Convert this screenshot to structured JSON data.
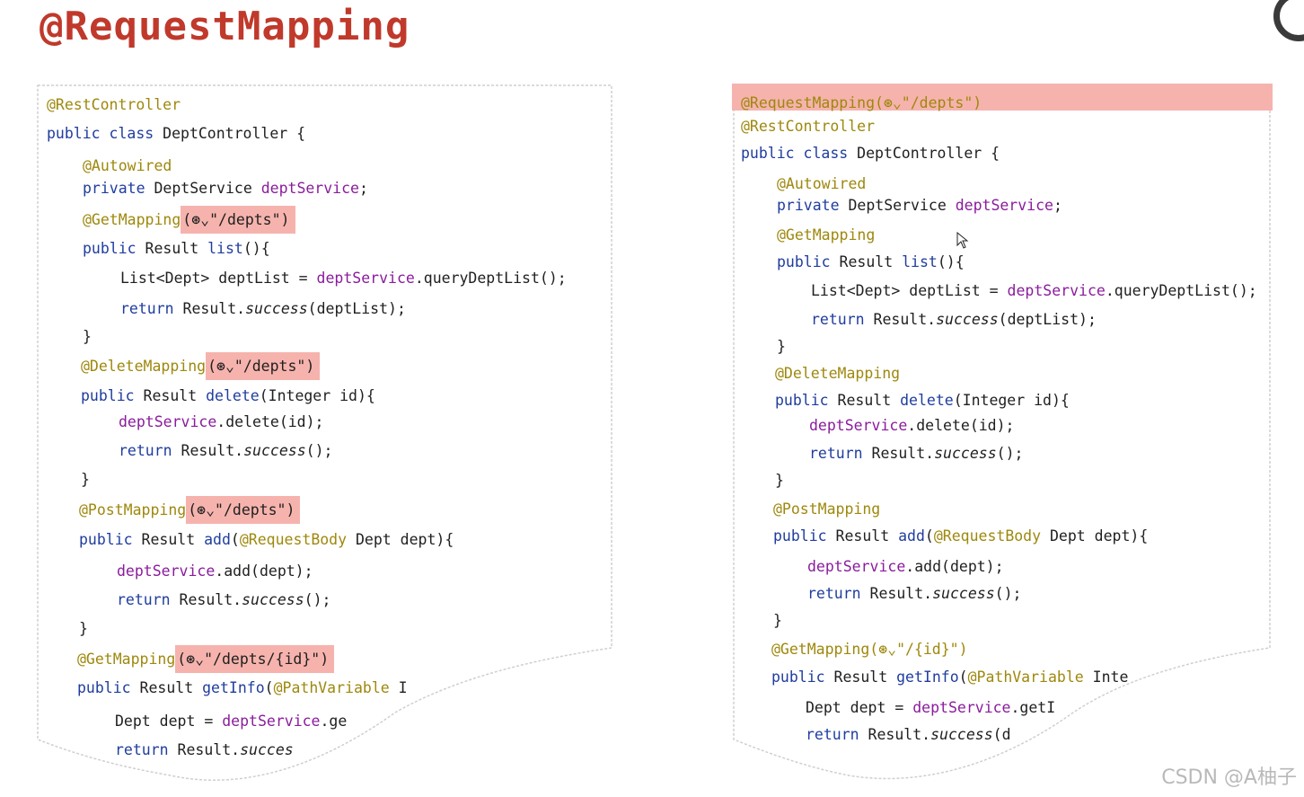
{
  "title": "@RequestMapping",
  "left": {
    "lines": [
      [
        {
          "t": "@RestController",
          "c": "ann"
        }
      ],
      [
        {
          "t": "public class ",
          "c": "kw"
        },
        {
          "t": "DeptController {",
          "c": ""
        }
      ],
      [
        {
          "t": "@Autowired",
          "c": "ann"
        }
      ],
      [
        {
          "t": "private ",
          "c": "kw"
        },
        {
          "t": "DeptService ",
          "c": ""
        },
        {
          "t": "deptService",
          "c": "fld"
        },
        {
          "t": ";",
          "c": ""
        }
      ],
      [
        {
          "t": "@GetMapping",
          "c": "ann"
        },
        {
          "t": "(⊛⌄\"/depts\")",
          "c": "hl"
        }
      ],
      [
        {
          "t": "public ",
          "c": "kw"
        },
        {
          "t": "Result ",
          "c": ""
        },
        {
          "t": "list",
          "c": "kw"
        },
        {
          "t": "(){",
          "c": ""
        }
      ],
      [
        {
          "t": "List<Dept> deptList = ",
          "c": ""
        },
        {
          "t": "deptService",
          "c": "fld"
        },
        {
          "t": ".queryDeptList();",
          "c": ""
        }
      ],
      [
        {
          "t": "return ",
          "c": "kw"
        },
        {
          "t": "Result.",
          "c": ""
        },
        {
          "t": "success",
          "c": "it"
        },
        {
          "t": "(deptList);",
          "c": ""
        }
      ],
      [
        {
          "t": "}",
          "c": ""
        }
      ],
      [
        {
          "t": "@DeleteMapping",
          "c": "ann"
        },
        {
          "t": "(⊛⌄\"/depts\")",
          "c": "hl"
        }
      ],
      [
        {
          "t": "public ",
          "c": "kw"
        },
        {
          "t": "Result ",
          "c": ""
        },
        {
          "t": "delete",
          "c": "kw"
        },
        {
          "t": "(Integer id){",
          "c": ""
        }
      ],
      [
        {
          "t": "deptService",
          "c": "fld"
        },
        {
          "t": ".delete(id);",
          "c": ""
        }
      ],
      [
        {
          "t": "return ",
          "c": "kw"
        },
        {
          "t": "Result.",
          "c": ""
        },
        {
          "t": "success",
          "c": "it"
        },
        {
          "t": "();",
          "c": ""
        }
      ],
      [
        {
          "t": "}",
          "c": ""
        }
      ],
      [
        {
          "t": "@PostMapping",
          "c": "ann"
        },
        {
          "t": "(⊛⌄\"/depts\")",
          "c": "hl"
        }
      ],
      [
        {
          "t": "public ",
          "c": "kw"
        },
        {
          "t": "Result ",
          "c": ""
        },
        {
          "t": "add",
          "c": "kw"
        },
        {
          "t": "(",
          "c": ""
        },
        {
          "t": "@RequestBody ",
          "c": "ann"
        },
        {
          "t": "Dept dept){",
          "c": ""
        }
      ],
      [
        {
          "t": "deptService",
          "c": "fld"
        },
        {
          "t": ".add(dept);",
          "c": ""
        }
      ],
      [
        {
          "t": "return ",
          "c": "kw"
        },
        {
          "t": "Result.",
          "c": ""
        },
        {
          "t": "success",
          "c": "it"
        },
        {
          "t": "();",
          "c": ""
        }
      ],
      [
        {
          "t": "}",
          "c": ""
        }
      ],
      [
        {
          "t": "@GetMapping",
          "c": "ann"
        },
        {
          "t": "(⊛⌄\"/depts/{id}\")",
          "c": "hl"
        }
      ],
      [
        {
          "t": "public ",
          "c": "kw"
        },
        {
          "t": "Result ",
          "c": ""
        },
        {
          "t": "getInfo",
          "c": "kw"
        },
        {
          "t": "(",
          "c": ""
        },
        {
          "t": "@PathVariable ",
          "c": "ann"
        },
        {
          "t": "I",
          "c": ""
        }
      ],
      [
        {
          "t": "Dept dept = ",
          "c": ""
        },
        {
          "t": "deptService",
          "c": "fld"
        },
        {
          "t": ".ge",
          "c": ""
        }
      ],
      [
        {
          "t": "return ",
          "c": "kw"
        },
        {
          "t": "Result.",
          "c": ""
        },
        {
          "t": "succes",
          "c": "it"
        }
      ]
    ]
  },
  "right": {
    "lines": [
      [
        {
          "t": "@RequestMapping(⊛⌄\"/depts\")",
          "c": "ann"
        }
      ],
      [
        {
          "t": "@RestController",
          "c": "ann"
        }
      ],
      [
        {
          "t": "public class ",
          "c": "kw"
        },
        {
          "t": "DeptController {",
          "c": ""
        }
      ],
      [
        {
          "t": "@Autowired",
          "c": "ann"
        }
      ],
      [
        {
          "t": "private ",
          "c": "kw"
        },
        {
          "t": "DeptService ",
          "c": ""
        },
        {
          "t": "deptService",
          "c": "fld"
        },
        {
          "t": ";",
          "c": ""
        }
      ],
      [
        {
          "t": "@GetMapping",
          "c": "ann"
        }
      ],
      [
        {
          "t": "public ",
          "c": "kw"
        },
        {
          "t": "Result ",
          "c": ""
        },
        {
          "t": "list",
          "c": "kw"
        },
        {
          "t": "(){",
          "c": ""
        }
      ],
      [
        {
          "t": "List<Dept> deptList = ",
          "c": ""
        },
        {
          "t": "deptService",
          "c": "fld"
        },
        {
          "t": ".queryDeptList();",
          "c": ""
        }
      ],
      [
        {
          "t": "return ",
          "c": "kw"
        },
        {
          "t": "Result.",
          "c": ""
        },
        {
          "t": "success",
          "c": "it"
        },
        {
          "t": "(deptList);",
          "c": ""
        }
      ],
      [
        {
          "t": "}",
          "c": ""
        }
      ],
      [
        {
          "t": "@DeleteMapping",
          "c": "ann"
        }
      ],
      [
        {
          "t": "public ",
          "c": "kw"
        },
        {
          "t": "Result ",
          "c": ""
        },
        {
          "t": "delete",
          "c": "kw"
        },
        {
          "t": "(Integer id){",
          "c": ""
        }
      ],
      [
        {
          "t": "deptService",
          "c": "fld"
        },
        {
          "t": ".delete(id);",
          "c": ""
        }
      ],
      [
        {
          "t": "return ",
          "c": "kw"
        },
        {
          "t": "Result.",
          "c": ""
        },
        {
          "t": "success",
          "c": "it"
        },
        {
          "t": "();",
          "c": ""
        }
      ],
      [
        {
          "t": "}",
          "c": ""
        }
      ],
      [
        {
          "t": "@PostMapping",
          "c": "ann"
        }
      ],
      [
        {
          "t": "public ",
          "c": "kw"
        },
        {
          "t": "Result ",
          "c": ""
        },
        {
          "t": "add",
          "c": "kw"
        },
        {
          "t": "(",
          "c": ""
        },
        {
          "t": "@RequestBody ",
          "c": "ann"
        },
        {
          "t": "Dept dept){",
          "c": ""
        }
      ],
      [
        {
          "t": "deptService",
          "c": "fld"
        },
        {
          "t": ".add(dept);",
          "c": ""
        }
      ],
      [
        {
          "t": "return ",
          "c": "kw"
        },
        {
          "t": "Result.",
          "c": ""
        },
        {
          "t": "success",
          "c": "it"
        },
        {
          "t": "();",
          "c": ""
        }
      ],
      [
        {
          "t": "}",
          "c": ""
        }
      ],
      [
        {
          "t": "@GetMapping(⊛⌄\"/{id}\")",
          "c": "ann"
        }
      ],
      [
        {
          "t": "public ",
          "c": "kw"
        },
        {
          "t": "Result ",
          "c": ""
        },
        {
          "t": "getInfo",
          "c": "kw"
        },
        {
          "t": "(",
          "c": ""
        },
        {
          "t": "@PathVariable ",
          "c": "ann"
        },
        {
          "t": "Inte",
          "c": ""
        }
      ],
      [
        {
          "t": "Dept dept = ",
          "c": ""
        },
        {
          "t": "deptService",
          "c": "fld"
        },
        {
          "t": ".getI",
          "c": ""
        }
      ],
      [
        {
          "t": "return ",
          "c": "kw"
        },
        {
          "t": "Result.",
          "c": ""
        },
        {
          "t": "success",
          "c": "it"
        },
        {
          "t": "(d",
          "c": ""
        }
      ]
    ]
  },
  "watermark": "CSDN @A柚子"
}
